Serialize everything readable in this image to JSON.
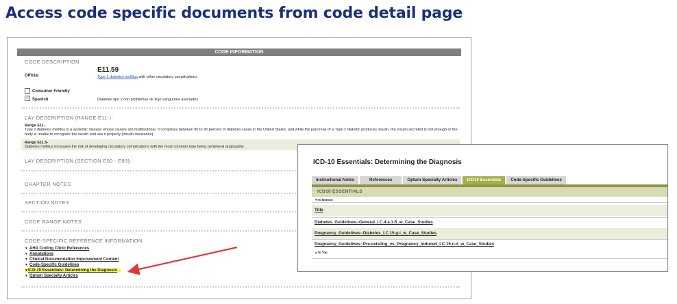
{
  "slide_title": "Access code specific documents from code detail page",
  "code_panel": {
    "bar_title": "CODE INFORMATION",
    "code_description_head": "CODE DESCRIPTION",
    "official_label": "Official",
    "code": "E11.59",
    "desc_link": "Type 2 diabetes mellitus",
    "desc_rest": " with other circulatory complications",
    "consumer_friendly_label": "Consumer Friendly",
    "consumer_friendly_checked": false,
    "spanish_label": "Spanish",
    "spanish_checked": true,
    "spanish_text": "Diabetes tipo 2 con problemas de flujo sanguíneo asociados",
    "lay_range_head": "LAY DESCRIPTION (RANGE E11-):",
    "range_e11_label": "Range E11-",
    "range_e11_text": "Type 2 diabetes mellitus is a systemic disease whose causes are multifactorial. It comprises between 90 to 95 percent of diabetes cases in the United States, and while the pancreas of a Type 2 diabetic produces insulin, the insulin secreted is not enough or the body is unable to recognize the insulin and use it properly (insulin resistance).",
    "range_e115_label": "Range E11.5-",
    "range_e115_text": "Diabetes mellitus increases the risk of developing circulatory complications with the most common type being peripheral angiopathy.",
    "lay_section_head": "LAY DESCRIPTION (SECTION E00 - E89):",
    "chapter_notes_head": "CHAPTER NOTES",
    "section_notes_head": "SECTION NOTES",
    "code_range_notes_head": "CODE RANGE NOTES",
    "ref_info_head": "CODE-SPECIFIC REFERENCE INFORMATION",
    "ref_items": [
      "AHA Coding Clinic References",
      "Annotations",
      "Clinical Documentation Improvement Content",
      "Code-Specific Guidelines",
      "ICD-10 Essentials: Determining the Diagnosis",
      "Optum Specialty Articles"
    ]
  },
  "overlay": {
    "title": "ICD-10 Essentials: Determining the Diagnosis",
    "tabs": [
      "Instructional Notes",
      "References",
      "Optum Specialty Articles",
      "ICD10 Essentials",
      "Code-Specific Guidelines"
    ],
    "active_tab": "ICD10 Essentials",
    "section_head": "ICD10 ESSENTIALS",
    "to_bottom": "▼To Bottom",
    "column_title": "Title",
    "rows": [
      "Diabetes_Guidelines--General_I.C.4.a.1-5_w_Case_Studies",
      "Pregnancy_Guidelines--Diabetes_I.C.15.g-i_w_Case_Studies",
      "Pregnancy_Guidelines--Pre-existing_vs_Pregnancy_Induced_I.C.15.c-d_w_Case_Studies"
    ],
    "to_top": "▲To Top"
  },
  "colors": {
    "title_blue": "#1a2f7a",
    "highlight_yellow": "#f5f73a",
    "tab_active_olive": "#a6ad4a",
    "arrow_red": "#e0393a"
  }
}
